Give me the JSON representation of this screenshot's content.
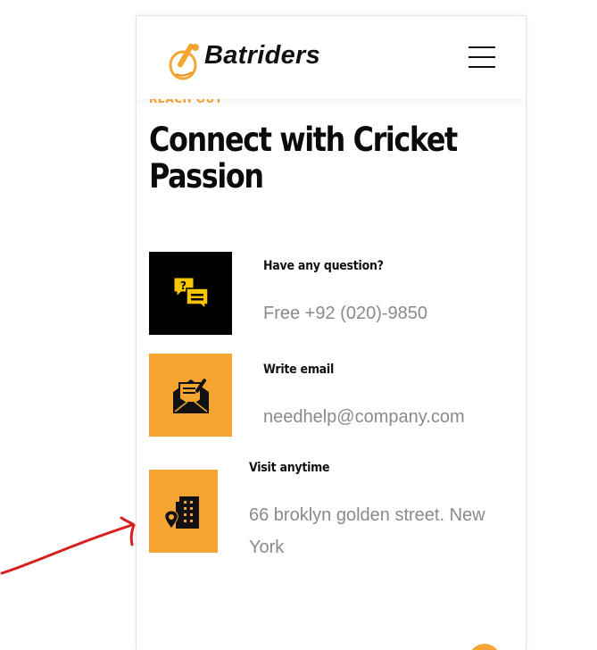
{
  "header": {
    "brand": "Batriders"
  },
  "section": {
    "eyebrow": "REACH OUT",
    "title": "Connect with Cricket Passion"
  },
  "contacts": [
    {
      "label": "Have any question?",
      "value": "Free +92 (020)-9850",
      "icon": "chat-question-icon"
    },
    {
      "label": "Write email",
      "value": "needhelp@company.com",
      "icon": "envelope-icon"
    },
    {
      "label": "Visit anytime",
      "value": "66 broklyn golden street. New York",
      "icon": "building-location-icon"
    }
  ],
  "colors": {
    "accent": "#f6a532",
    "dark": "#000000",
    "annotation": "#d62020"
  }
}
